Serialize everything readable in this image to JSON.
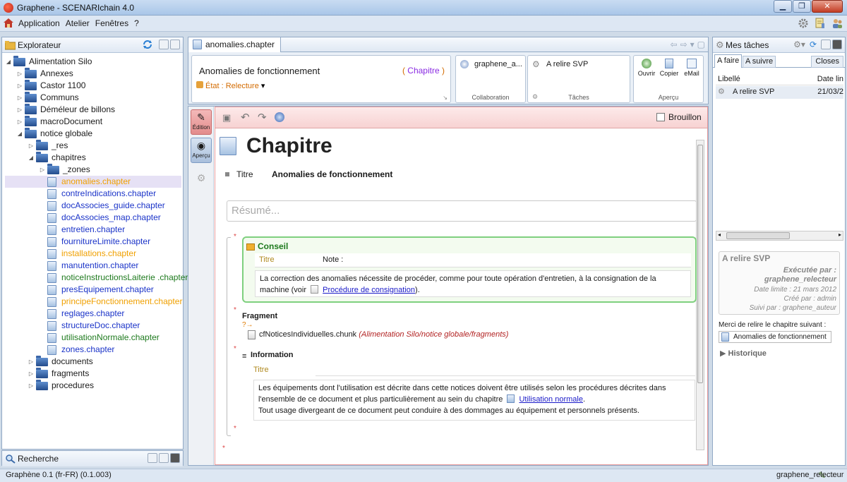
{
  "window": {
    "title": "Graphene - SCENARIchain 4.0"
  },
  "menu": {
    "items": [
      "Application",
      "Atelier",
      "Fenêtres",
      "?"
    ]
  },
  "explorer": {
    "title": "Explorateur",
    "tree": [
      {
        "label": "Alimentation Silo",
        "level": 0,
        "type": "folder",
        "expanded": true,
        "color": ""
      },
      {
        "label": "Annexes",
        "level": 1,
        "type": "folder",
        "expanded": false,
        "color": ""
      },
      {
        "label": "Castor 1100",
        "level": 1,
        "type": "folder",
        "expanded": false,
        "color": ""
      },
      {
        "label": "Communs",
        "level": 1,
        "type": "folder",
        "expanded": false,
        "color": ""
      },
      {
        "label": "Déméleur de billons",
        "level": 1,
        "type": "folder",
        "expanded": false,
        "color": ""
      },
      {
        "label": "macroDocument",
        "level": 1,
        "type": "folder",
        "expanded": false,
        "color": ""
      },
      {
        "label": "notice globale",
        "level": 1,
        "type": "folder",
        "expanded": true,
        "color": ""
      },
      {
        "label": "_res",
        "level": 2,
        "type": "folder",
        "expanded": false,
        "color": ""
      },
      {
        "label": "chapitres",
        "level": 2,
        "type": "folder",
        "expanded": true,
        "color": ""
      },
      {
        "label": "_zones",
        "level": 3,
        "type": "folder",
        "expanded": false,
        "color": ""
      },
      {
        "label": "anomalies.chapter",
        "level": 3,
        "type": "doc",
        "color": "orange",
        "selected": true
      },
      {
        "label": "contreIndications.chapter",
        "level": 3,
        "type": "doc",
        "color": "blue"
      },
      {
        "label": "docAssocies_guide.chapter",
        "level": 3,
        "type": "doc",
        "color": "blue"
      },
      {
        "label": "docAssocies_map.chapter",
        "level": 3,
        "type": "doc",
        "color": "blue"
      },
      {
        "label": "entretien.chapter",
        "level": 3,
        "type": "doc",
        "color": "blue"
      },
      {
        "label": "fournitureLimite.chapter",
        "level": 3,
        "type": "doc",
        "color": "blue"
      },
      {
        "label": "installations.chapter",
        "level": 3,
        "type": "doc",
        "color": "orange"
      },
      {
        "label": "manutention.chapter",
        "level": 3,
        "type": "doc",
        "color": "blue"
      },
      {
        "label": "noticeInstructionsLaiterie .chapter",
        "level": 3,
        "type": "doc",
        "color": "green"
      },
      {
        "label": "presEquipement.chapter",
        "level": 3,
        "type": "doc",
        "color": "blue"
      },
      {
        "label": "principeFonctionnement.chapter",
        "level": 3,
        "type": "doc",
        "color": "orange"
      },
      {
        "label": "reglages.chapter",
        "level": 3,
        "type": "doc",
        "color": "blue"
      },
      {
        "label": "structureDoc.chapter",
        "level": 3,
        "type": "doc",
        "color": "blue"
      },
      {
        "label": "utilisationNormale.chapter",
        "level": 3,
        "type": "doc",
        "color": "green"
      },
      {
        "label": "zones.chapter",
        "level": 3,
        "type": "doc",
        "color": "blue"
      },
      {
        "label": "documents",
        "level": 2,
        "type": "folder",
        "expanded": false,
        "color": ""
      },
      {
        "label": "fragments",
        "level": 2,
        "type": "folder",
        "expanded": false,
        "color": ""
      },
      {
        "label": "procedures",
        "level": 2,
        "type": "folder",
        "expanded": false,
        "color": ""
      }
    ]
  },
  "search": {
    "title": "Recherche"
  },
  "editor": {
    "tab": "anomalies.chapter",
    "ribbon": {
      "doc_title": "Anomalies de fonctionnement",
      "doc_type": "Chapitre",
      "state": "État : Relecture",
      "collab_user": "graphene_a...",
      "collab_caption": "Collaboration",
      "task_name": "A relire SVP",
      "tasks_caption": "Tâches",
      "preview_buttons": [
        "Ouvrir",
        "Copier",
        "eMail"
      ],
      "preview_caption": "Aperçu"
    },
    "side_tools": {
      "edit": "Édition",
      "preview": "Aperçu"
    },
    "draft_label": "Brouillon",
    "content": {
      "heading": "Chapitre",
      "title_label": "Titre",
      "title_value": "Anomalies de fonctionnement",
      "summary_placeholder": "Résumé...",
      "conseil": {
        "label": "Conseil",
        "title_label": "Titre",
        "title_value": "Note :",
        "text_before": "La correction des anomalies nécessite de procéder, comme pour toute opération d'entretien, à la consignation de la machine (voir",
        "link": "Procédure de consignation",
        "text_after": ")."
      },
      "fragment": {
        "label": "Fragment",
        "file": "cfNoticesIndividuelles.chunk",
        "path": "(Alimentation Silo/notice globale/fragments)"
      },
      "information": {
        "label": "Information",
        "title_label": "Titre",
        "text1_before": "Les équipements dont l'utilisation est décrite dans cette notices doivent être utilisés selon les procédures décrites dans l'ensemble de ce document et plus particulièrement au sein du chapitre",
        "link": "Utilisation normale",
        "text1_after": ".",
        "text2": "Tout usage divergeant de ce document peut conduire à des dommages au équipement et personnels présents."
      }
    }
  },
  "tasks": {
    "title": "Mes tâches",
    "tabs": [
      "A faire",
      "A suivre",
      "Closes"
    ],
    "columns": [
      "Libellé",
      "Date lin"
    ],
    "rows": [
      {
        "label": "A relire SVP",
        "date": "21/03/2"
      }
    ],
    "detail": {
      "title": "A relire SVP",
      "executed_by_label": "Exécutée par :",
      "executed_by": "graphene_relecteur",
      "deadline": "Date limite : 21 mars 2012",
      "created_by": "Créé par : admin",
      "followed_by": "Suivi par : graphene_auteur"
    },
    "message": "Merci de relire le chapitre suivant :",
    "chapter_ref": "Anomalies de fonctionnement",
    "history": "Historique"
  },
  "status": {
    "version": "Graphène 0.1 (fr-FR) (0.1.003)",
    "user": "graphene_relecteur"
  },
  "colors": {
    "blue": "#1a33c8",
    "green": "#1e7a1e",
    "orange": "#f0a000"
  }
}
